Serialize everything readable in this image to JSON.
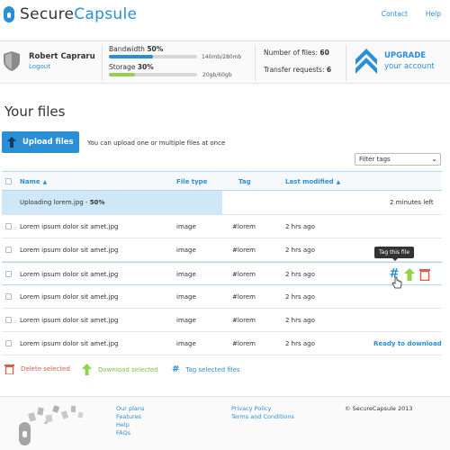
{
  "header": {
    "logo_part1": "Secure",
    "logo_part2": "Capsule",
    "links": {
      "contact": "Contact",
      "help": "Help"
    }
  },
  "status": {
    "user_name": "Robert Capraru",
    "logout": "Logout",
    "bandwidth": {
      "label": "Bandwidth",
      "percent_label": "50%",
      "fraction": 0.5,
      "value": "140mb/280mb",
      "color": "#2a8fd4"
    },
    "storage": {
      "label": "Storage",
      "percent_label": "30%",
      "fraction": 0.3,
      "value": "20gb/60gb",
      "color": "#8fd44a"
    },
    "files_label": "Number of files:",
    "files_count": "60",
    "transfers_label": "Transfer requests:",
    "transfers_count": "6",
    "upgrade_top": "UPGRADE",
    "upgrade_bottom": "your account"
  },
  "page": {
    "title": "Your files",
    "upload_button": "Upload files",
    "upload_hint": "You can upload one or multiple files at once",
    "filter_placeholder": "Filter tags"
  },
  "table": {
    "columns": {
      "name": "Name",
      "type": "File type",
      "tag": "Tag",
      "modified": "Last modified"
    },
    "uploading": {
      "label": "Uploading lorem.jpg - ",
      "percent": "50%",
      "fraction": 0.5,
      "remaining": "2 minutes left"
    },
    "rows": [
      {
        "name": "Lorem ipsum dolor sit amet.jpg",
        "type": "image",
        "tag": "#lorem",
        "modified": "2 hrs ago"
      },
      {
        "name": "Lorem ipsum dolor sit amet.jpg",
        "type": "image",
        "tag": "#lorem",
        "modified": "2 hrs ago"
      },
      {
        "name": "Lorem ipsum dolor sit amet.jpg",
        "type": "image",
        "tag": "#lorem",
        "modified": "2 hrs ago"
      },
      {
        "name": "Lorem ipsum dolor sit amet.jpg",
        "type": "image",
        "tag": "#lorem",
        "modified": "2 hrs ago"
      },
      {
        "name": "Lorem ipsum dolor sit amet.jpg",
        "type": "image",
        "tag": "#lorem",
        "modified": "2 hrs ago"
      },
      {
        "name": "Lorem ipsum dolor sit amet.jpg",
        "type": "image",
        "tag": "#lorem",
        "modified": "2 hrs ago"
      }
    ],
    "tooltip": "Tag this file",
    "ready": "Ready to download"
  },
  "bulk": {
    "delete": "Delete selected",
    "download": "Download selected",
    "tag": "Tag selected files"
  },
  "footer": {
    "col1": [
      "Our plans",
      "Features",
      "Help",
      "FAQs"
    ],
    "col2": [
      "Privacy Policy",
      "Terms and Conditions"
    ],
    "copyright": "© SecureCapsule 2013"
  },
  "colors": {
    "accent": "#2a8fd4",
    "green": "#8fd44a",
    "red": "#e05a4a"
  }
}
